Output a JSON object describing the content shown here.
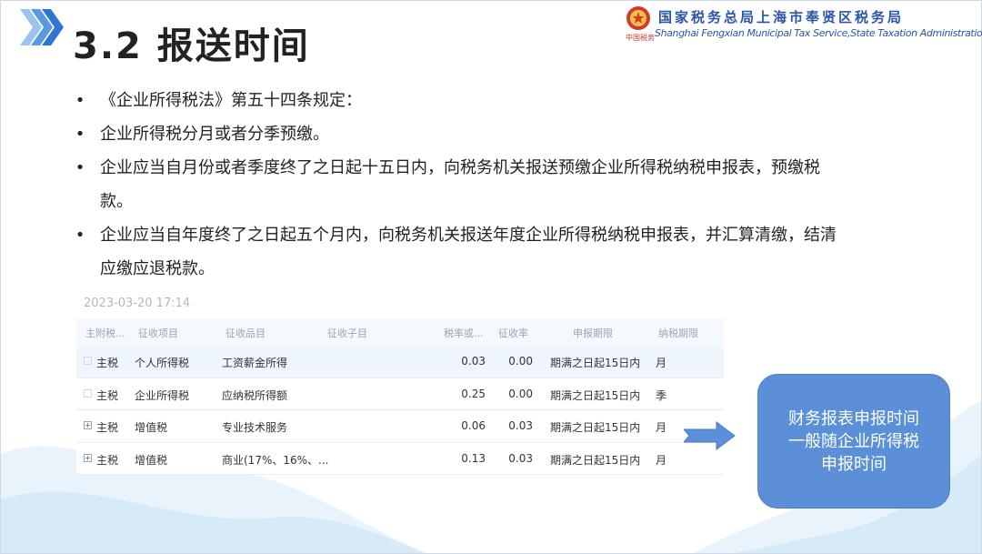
{
  "header": {
    "title": "3.2 报送时间",
    "org_cn": "国家税务总局上海市奉贤区税务局",
    "org_en": "Shanghai Fengxian Municipal Tax Service,State Taxation Administration",
    "org_signature": "中国税务"
  },
  "bullets": [
    {
      "marker": "•",
      "text": "《企业所得税法》第五十四条规定："
    },
    {
      "marker": "•",
      "text": "企业所得税分月或者分季预缴。"
    },
    {
      "marker": "•",
      "text": "企业应当自月份或者季度终了之日起十五日内，向税务机关报送预缴企业所得税纳税申报表，预缴税款。"
    },
    {
      "marker": "•",
      "text": "企业应当自年度终了之日起五个月内，向税务机关报送年度企业所得税纳税申报表，并汇算清缴，结清应缴应退税款。"
    }
  ],
  "screenshot": {
    "timestamp": "2023-03-20 17:14",
    "columns": [
      "主附税...",
      "征收项目",
      "征收品目",
      "征收子目",
      "税率或...",
      "征收率",
      "申报期限",
      "纳税期限"
    ],
    "rows": [
      {
        "expander": "□",
        "type": "主税",
        "item": "个人所得税",
        "subitem": "工资薪金所得",
        "subsub": "",
        "rate": "0.03",
        "levy": "0.00",
        "deadline": "期满之日起15日内",
        "period": "月"
      },
      {
        "expander": "□",
        "type": "主税",
        "item": "企业所得税",
        "subitem": "应纳税所得额",
        "subsub": "",
        "rate": "0.25",
        "levy": "0.00",
        "deadline": "期满之日起15日内",
        "period": "季"
      },
      {
        "expander": "+",
        "type": "主税",
        "item": "增值税",
        "subitem": "专业技术服务",
        "subsub": "",
        "rate": "0.06",
        "levy": "0.03",
        "deadline": "期满之日起15日内",
        "period": "月"
      },
      {
        "expander": "+",
        "type": "主税",
        "item": "增值税",
        "subitem": "商业(17%、16%、...",
        "subsub": "",
        "rate": "0.13",
        "levy": "0.03",
        "deadline": "期满之日起15日内",
        "period": "月"
      }
    ]
  },
  "callout": {
    "lines": [
      "财务报表申报时间",
      "一般随企业所得税",
      "申报时间"
    ]
  },
  "colors": {
    "accent": "#2b55a8",
    "callout_bg": "#5b8fd8",
    "arrow": "#5b8fd8",
    "chevron": "#3a7bd5"
  },
  "icons": {
    "title_marker": "chevron-triple-icon",
    "emblem": "national-emblem-icon",
    "arrow": "right-arrow-icon"
  }
}
